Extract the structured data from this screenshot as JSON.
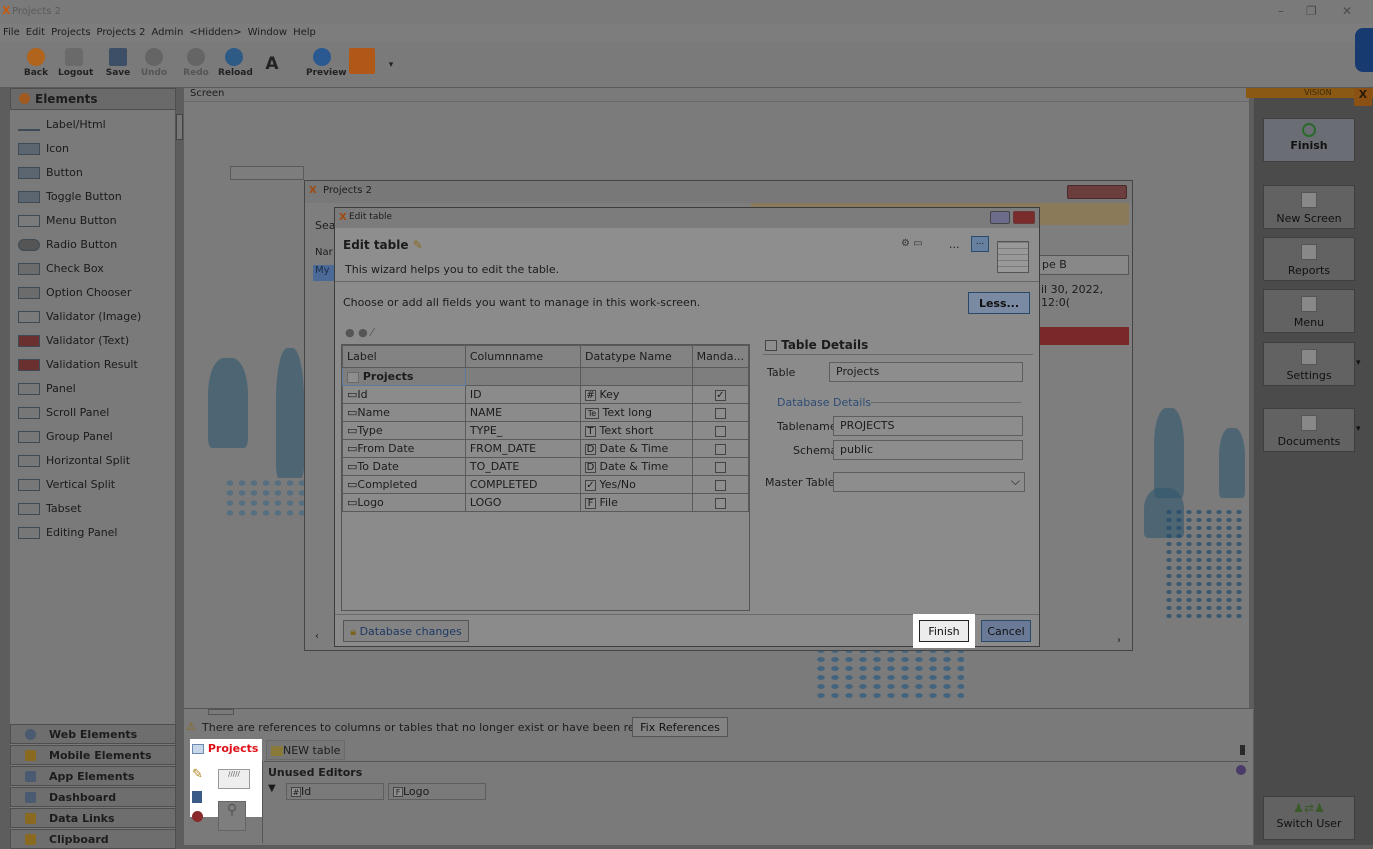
{
  "window": {
    "title": "Projects 2",
    "minimize": "–",
    "restore": "❐",
    "close": "✕"
  },
  "menu": [
    "File",
    "Edit",
    "Projects",
    "Projects 2",
    "Admin",
    "<Hidden>",
    "Window",
    "Help"
  ],
  "toolbar": {
    "back": "Back",
    "logout": "Logout",
    "save": "Save",
    "undo": "Undo",
    "redo": "Redo",
    "reload": "Reload",
    "preview": "Preview",
    "font_glyph": "A"
  },
  "left_panel": {
    "header": "Elements",
    "items": [
      "Label/Html",
      "Icon",
      "Button",
      "Toggle Button",
      "Menu Button",
      "Radio Button",
      "Check Box",
      "Option Chooser",
      "Validator (Image)",
      "Validator (Text)",
      "Validation Result",
      "Panel",
      "Scroll Panel",
      "Group Panel",
      "Horizontal Split",
      "Vertical Split",
      "Tabset",
      "Editing Panel"
    ],
    "footer": [
      "Web Elements",
      "Mobile Elements",
      "App Elements",
      "Dashboard",
      "Data Links",
      "Clipboard"
    ]
  },
  "screen_tab": "Screen",
  "right_panel": {
    "brand": "VISION",
    "finish": "Finish",
    "new_screen": "New Screen",
    "reports": "Reports",
    "menu": "Menu",
    "settings": "Settings",
    "documents": "Documents",
    "switch_user": "Switch User"
  },
  "outer_dialog": {
    "title": "Projects 2",
    "search_partial": "Sea",
    "name_partial": "Nar",
    "my_partial": "My",
    "field_b": "pe B",
    "date_partial": "il 30, 2022, 12:0("
  },
  "edit_dialog": {
    "window_title": "Edit table",
    "heading": "Edit table",
    "description": "This wizard helps you to edit the table.",
    "instruction": "Choose or add all fields you want to manage in this work-screen.",
    "less_button": "Less...",
    "ellipsis": "...",
    "columns": [
      "Label",
      "Columnname",
      "Datatype Name",
      "Manda..."
    ],
    "group_row": "Projects",
    "rows": [
      {
        "label": "Id",
        "column": "ID",
        "type_icon": "#",
        "type": "Key",
        "mandatory": "✓"
      },
      {
        "label": "Name",
        "column": "NAME",
        "type_icon": "Te",
        "type": "Text long",
        "mandatory": ""
      },
      {
        "label": "Type",
        "column": "TYPE_",
        "type_icon": "T",
        "type": "Text short",
        "mandatory": ""
      },
      {
        "label": "From Date",
        "column": "FROM_DATE",
        "type_icon": "D",
        "type": "Date & Time",
        "mandatory": ""
      },
      {
        "label": "To Date",
        "column": "TO_DATE",
        "type_icon": "D",
        "type": "Date & Time",
        "mandatory": ""
      },
      {
        "label": "Completed",
        "column": "COMPLETED",
        "type_icon": "✓",
        "type": "Yes/No",
        "mandatory": ""
      },
      {
        "label": "Logo",
        "column": "LOGO",
        "type_icon": "F",
        "type": "File",
        "mandatory": ""
      }
    ],
    "details": {
      "title": "Table Details",
      "table_label": "Table",
      "table_value": "Projects",
      "db_section": "Database Details",
      "tablename_label": "Tablename",
      "tablename_value": "PROJECTS",
      "schema_label": "Schema",
      "schema_value": "public",
      "master_label": "Master Table",
      "master_value": ""
    },
    "db_changes": "Database changes",
    "finish": "Finish",
    "cancel": "Cancel"
  },
  "bottom": {
    "warning": "There are references to columns or tables that no longer exist or have been renamed.",
    "fix_button": "Fix References",
    "tabs": [
      "Projects",
      "NEW table"
    ],
    "unused_editors": "Unused Editors",
    "editors": [
      {
        "icon": "#",
        "label": "Id"
      },
      {
        "icon": "F",
        "label": "Logo"
      }
    ]
  },
  "colors": {
    "accent_orange": "#e8a020",
    "highlight_red": "#e0101a",
    "selection_blue": "#3c6db6"
  }
}
